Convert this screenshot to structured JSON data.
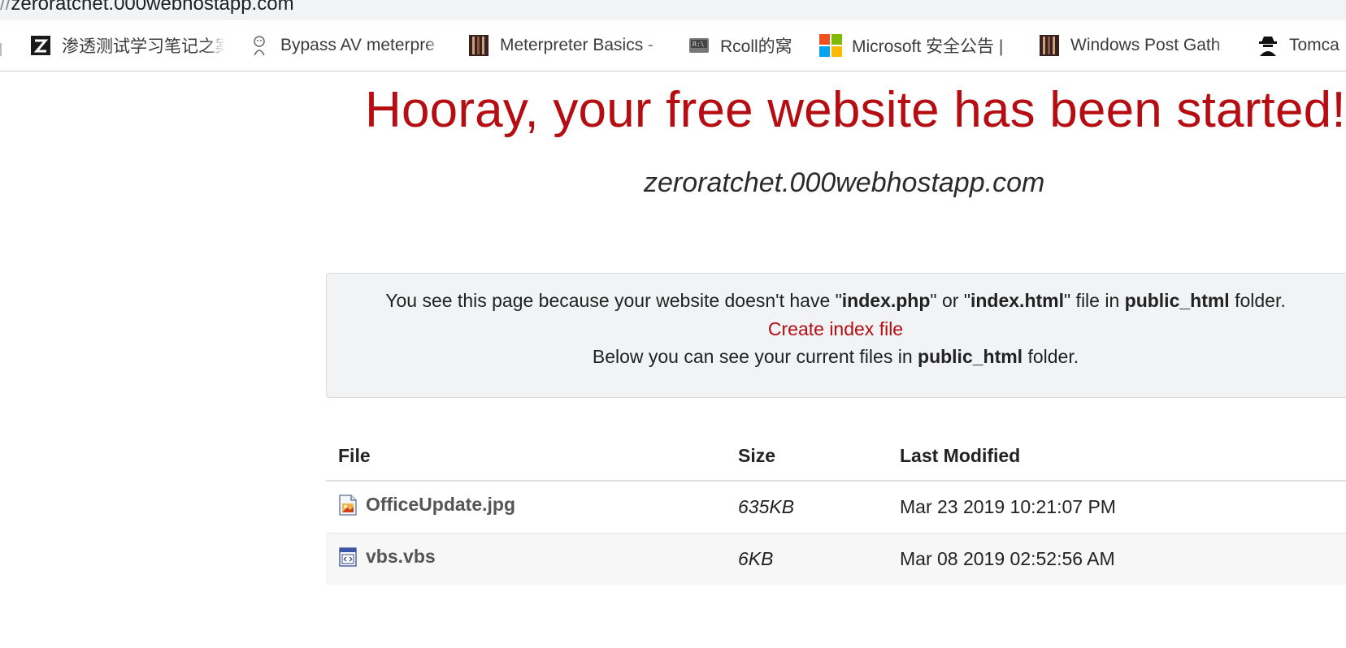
{
  "browser": {
    "address": {
      "scheme_fragment": "//",
      "host": "zeroratchet.000webhostapp.com"
    },
    "bookmarks": [
      {
        "label": "渗透测试学习笔记之案",
        "icon": "zhihu-z-icon"
      },
      {
        "label": "Bypass AV meterpre",
        "icon": "cartoon-face-icon"
      },
      {
        "label": "Meterpreter Basics -",
        "icon": "film-strip-icon"
      },
      {
        "label": "Rcoll的窝",
        "icon": "terminal-drive-icon"
      },
      {
        "label": "Microsoft 安全公告 |",
        "icon": "microsoft-logo-icon"
      },
      {
        "label": "Windows Post Gath",
        "icon": "film-strip-icon"
      },
      {
        "label": "Tomca",
        "icon": "spy-agent-icon"
      }
    ]
  },
  "page": {
    "title": "Hooray, your free website has been started!",
    "subtitle": "zeroratchet.000webhostapp.com",
    "notice": {
      "line1_a": "You see this page because your website doesn't have \"",
      "line1_b": "index.php",
      "line1_c": "\" or \"",
      "line1_d": "index.html",
      "line1_e": "\" file in ",
      "line1_f": "public_html",
      "line1_g": " folder.",
      "create_link": "Create index file",
      "line3_a": "Below you can see your current files in ",
      "line3_b": "public_html",
      "line3_c": " folder."
    },
    "colors": {
      "accent_red": "#b50d12",
      "notice_bg": "#f2f3f4"
    }
  },
  "files_table": {
    "headers": {
      "file": "File",
      "size": "Size",
      "modified": "Last Modified"
    },
    "rows": [
      {
        "name": "OfficeUpdate.jpg",
        "size": "635KB",
        "modified": "Mar 23 2019 10:21:07 PM",
        "icon": "image-file-icon"
      },
      {
        "name": "vbs.vbs",
        "size": "6KB",
        "modified": "Mar 08 2019 02:52:56 AM",
        "icon": "script-file-icon"
      }
    ]
  }
}
